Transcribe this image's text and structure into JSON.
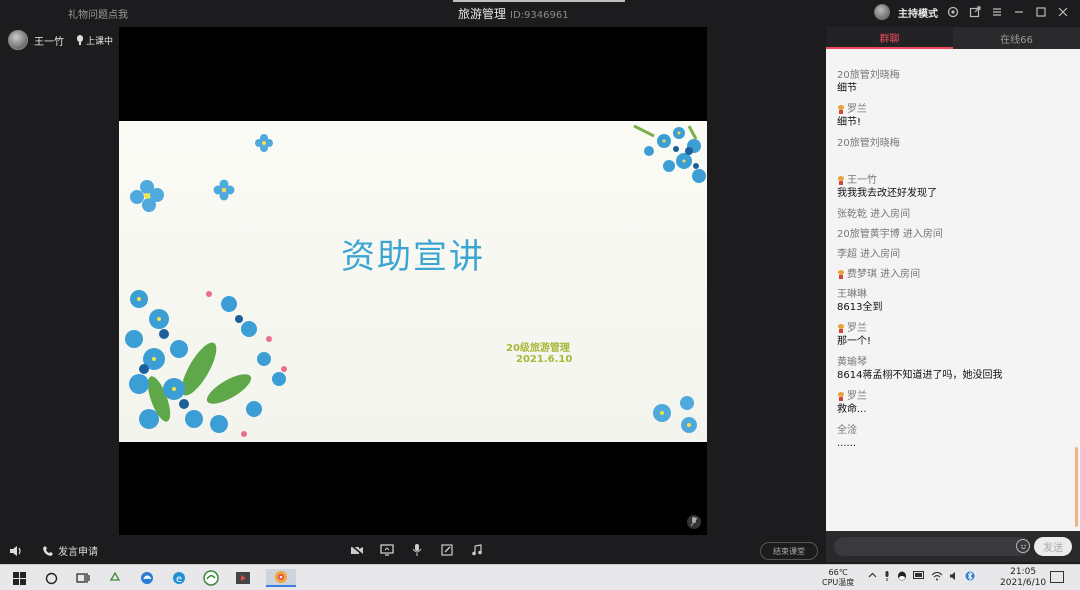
{
  "titlebar": {
    "left_link": "礼物问题点我",
    "course_title": "旅游管理",
    "room_id": "ID:9346961",
    "host_mode": "主持模式"
  },
  "user": {
    "name": "王一竹",
    "status": "上课中"
  },
  "slide": {
    "title": "资助宣讲",
    "subtitle": "20级旅游管理",
    "date": "2021.6.10"
  },
  "bottombar": {
    "apply_label": "发言申请",
    "end_label": "结束课堂"
  },
  "chat": {
    "tabs": [
      {
        "label": "群聊",
        "active": true
      },
      {
        "label": "在线66",
        "active": false
      }
    ],
    "messages": [
      {
        "sender": "20旅管刘晓梅",
        "body": "细节",
        "badge": false
      },
      {
        "sender": "罗兰",
        "body": "细节!",
        "badge": true
      },
      {
        "sender": "20旅管刘晓梅",
        "body": "",
        "badge": false
      },
      {
        "sender": "王一竹",
        "body": "我我我去改还好发现了",
        "badge": true
      },
      {
        "sender": "张乾乾 进入房间",
        "body": "",
        "badge": false
      },
      {
        "sender": "20旅管黄宇博 进入房间",
        "body": "",
        "badge": false
      },
      {
        "sender": "李超 进入房间",
        "body": "",
        "badge": false
      },
      {
        "sender": "费梦琪 进入房间",
        "body": "",
        "badge": true
      },
      {
        "sender": "王琳琳",
        "body": "8613全到",
        "badge": false
      },
      {
        "sender": "罗兰",
        "body": "那一个!",
        "badge": true
      },
      {
        "sender": "黄瑜琴",
        "body": "8614蒋孟栩不知道进了吗，她没回我",
        "badge": false
      },
      {
        "sender": "罗兰",
        "body": "救命...",
        "badge": true
      },
      {
        "sender": "全淦",
        "body": "......",
        "badge": false
      }
    ],
    "send_label": "发送"
  },
  "taskbar": {
    "temperature": "66℃",
    "cpu_label": "CPU温度",
    "time": "21:05",
    "date": "2021/6/10"
  },
  "colors": {
    "accent": "#ee4b5e",
    "slide_title": "#3ca5d2",
    "slide_subtitle": "#a8b83a"
  }
}
